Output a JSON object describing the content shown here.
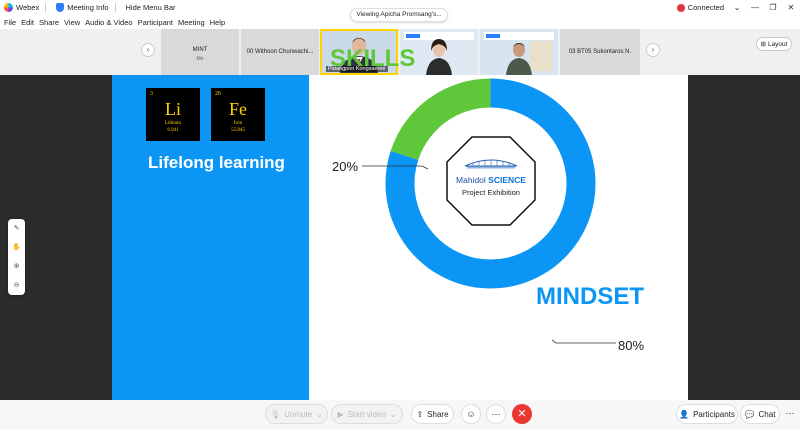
{
  "titlebar": {
    "app_name": "Webex",
    "meeting_info": "Meeting Info",
    "hide_menu": "Hide Menu Bar",
    "status": "Connected",
    "status_color": "#e0363d"
  },
  "menu": [
    "File",
    "Edit",
    "Share",
    "View",
    "Audio & Video",
    "Participant",
    "Meeting",
    "Help"
  ],
  "strip": {
    "tiles": [
      {
        "name": "MINT",
        "sub": "Me"
      },
      {
        "name": "00 Withoon Chunwachi..."
      },
      {
        "name": "Palangpon Kongsaeree"
      },
      {
        "name": ""
      },
      {
        "name": ""
      },
      {
        "name": "03 BT05 Sukontaros N."
      }
    ],
    "layout_label": "Layout"
  },
  "stage": {
    "viewing": "Viewing Apicha Promsang's...",
    "elements": [
      {
        "number": "3",
        "symbol": "Li",
        "name": "Lithium",
        "mass": "6.941"
      },
      {
        "number": "26",
        "symbol": "Fe",
        "name": "Iron",
        "mass": "55.845"
      }
    ],
    "lifelong": "Lifelong learning",
    "skills_label": "SKILLS",
    "mindset_label": "MINDSET",
    "skills_pct": "20%",
    "mindset_pct": "80%",
    "logo_line1_a": "Mahidol ",
    "logo_line1_b": "SCIENCE",
    "logo_line2": "Project Exhibition"
  },
  "chart_data": {
    "type": "pie",
    "categories": [
      "SKILLS",
      "MINDSET"
    ],
    "values": [
      20,
      80
    ],
    "colors": [
      "#5ec83a",
      "#0b96f5"
    ]
  },
  "bottombar": {
    "unmute": "Unmute",
    "start_video": "Start video",
    "share": "Share",
    "participants": "Participants",
    "chat": "Chat"
  }
}
